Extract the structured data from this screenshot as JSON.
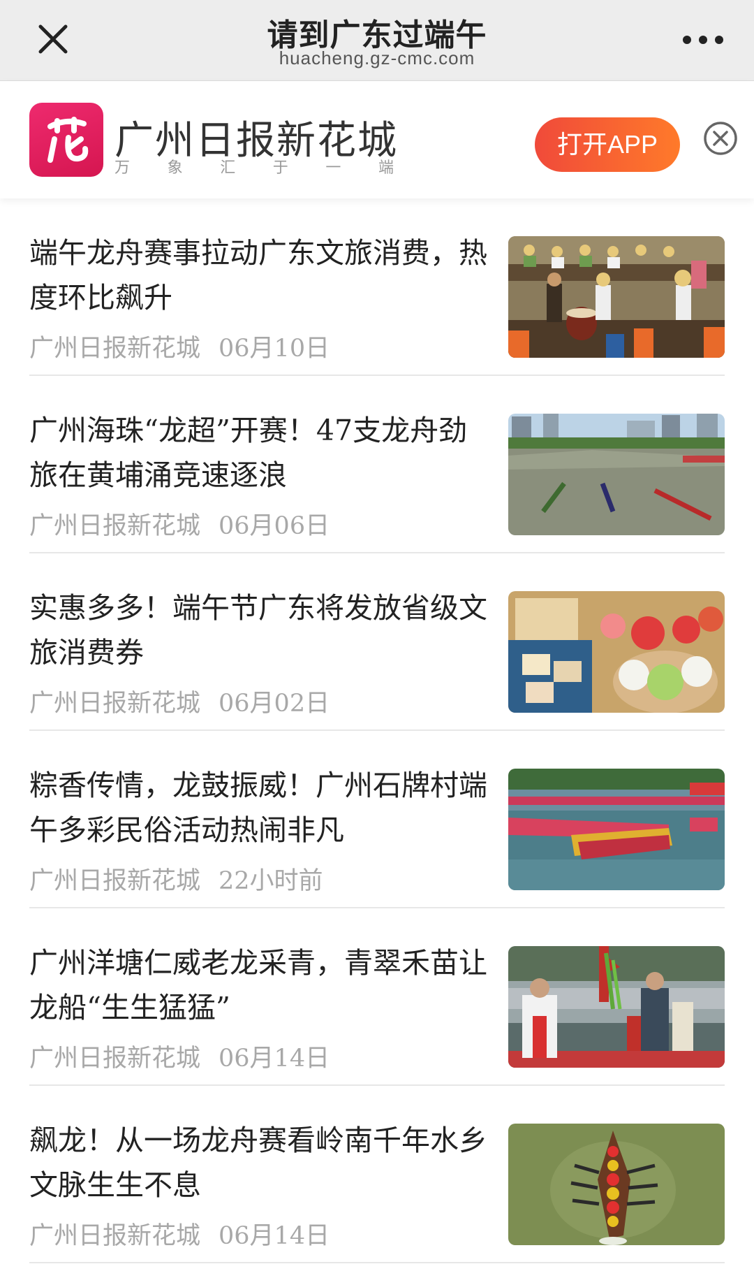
{
  "nav": {
    "title": "请到广东过端午",
    "url": "huacheng.gz-cmc.com"
  },
  "banner": {
    "brand": "广州日报新花城",
    "slogan": [
      "万",
      "象",
      "汇",
      "于",
      "一",
      "端"
    ],
    "open_app_label": "打开APP"
  },
  "news": [
    {
      "title": "端午龙舟赛事拉动广东文旅消费，热度环比飙升",
      "source": "广州日报新花城",
      "date": "06月10日",
      "image": "dragon-boat-drummers"
    },
    {
      "title": "广州海珠“龙超”开赛！47支龙舟劲旅在黄埔涌竞速逐浪",
      "source": "广州日报新花城",
      "date": "06月06日",
      "image": "river-race-aerial"
    },
    {
      "title": "实惠多多！端午节广东将发放省级文旅消费券",
      "source": "广州日报新花城",
      "date": "06月02日",
      "image": "festival-snacks"
    },
    {
      "title": "粽香传情，龙鼓振威！广州石牌村端午多彩民俗活动热闹非凡",
      "source": "广州日报新花城",
      "date": "22小时前",
      "image": "colorful-boat-procession"
    },
    {
      "title": "广州洋塘仁威老龙采青，青翠禾苗让龙船“生生猛猛”",
      "source": "广州日报新花城",
      "date": "06月14日",
      "image": "rice-seedling-ceremony"
    },
    {
      "title": "飙龙！从一场龙舟赛看岭南千年水乡文脉生生不息",
      "source": "广州日报新花城",
      "date": "06月14日",
      "image": "dragon-boat-topdown"
    }
  ],
  "colors": {
    "accent": "#f04a3a",
    "logo": "#e01f5c",
    "meta_text": "#a8a8a8"
  }
}
